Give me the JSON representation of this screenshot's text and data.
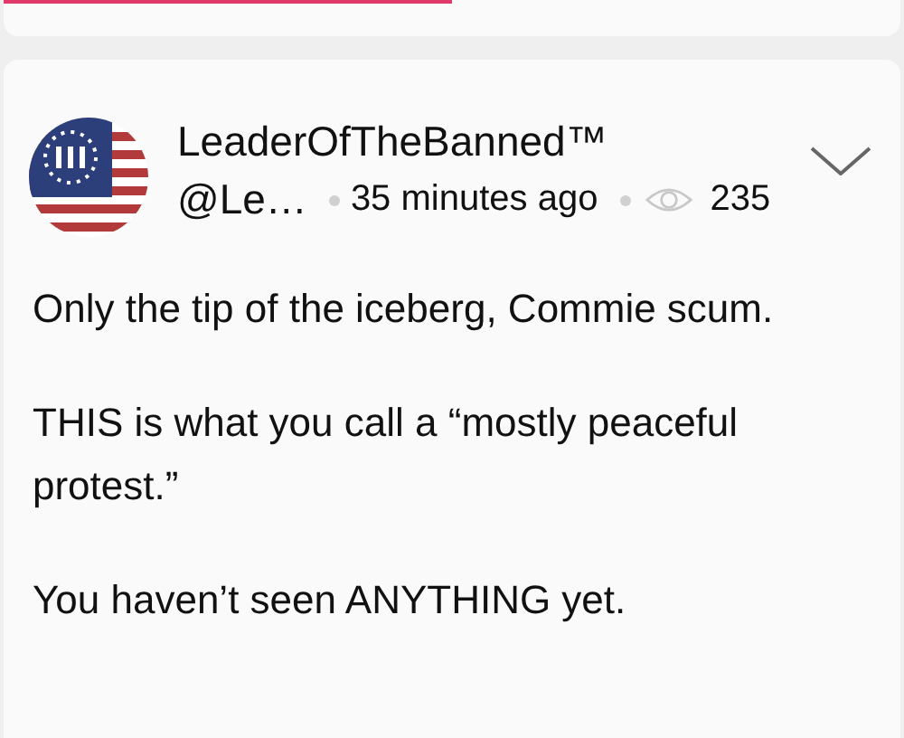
{
  "progress": {
    "level": 0.5
  },
  "post": {
    "author": "LeaderOfTheBanned™",
    "handle": "@Le…",
    "time": "35 minutes ago",
    "views": "235",
    "paragraphs": [
      "Only the tip of the iceberg, Commie scum.",
      "THIS is what you call a “mostly peaceful protest.”",
      "You haven’t seen ANYTHING yet."
    ]
  }
}
